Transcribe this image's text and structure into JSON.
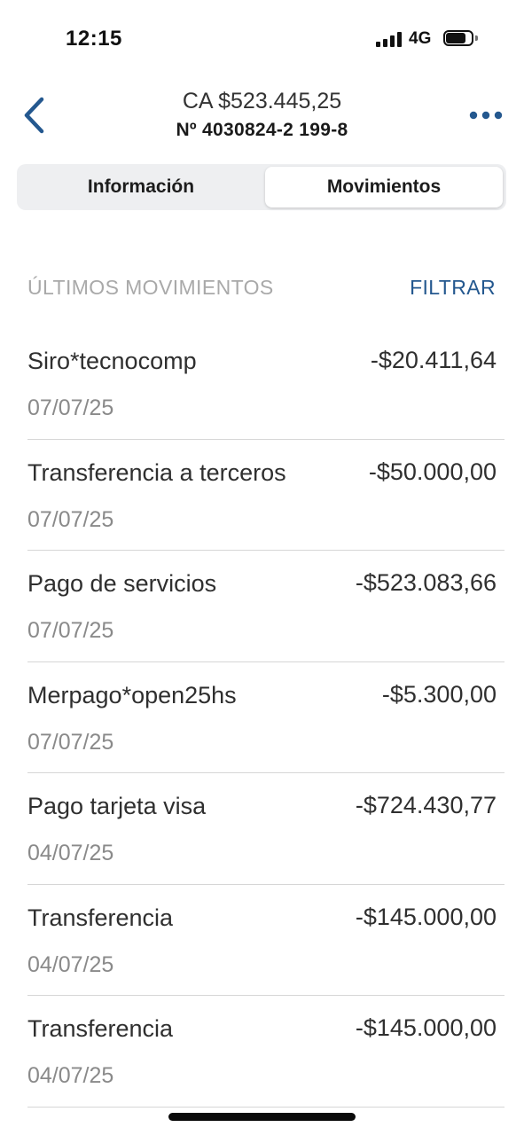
{
  "status_bar": {
    "time": "12:15",
    "network": "4G"
  },
  "header": {
    "account_title": "CA $523.445,25",
    "account_number": "Nº 4030824-2 199-8"
  },
  "tabs": [
    {
      "label": "Información",
      "selected": false
    },
    {
      "label": "Movimientos",
      "selected": true
    }
  ],
  "section": {
    "title": "ÚLTIMOS MOVIMIENTOS",
    "filter_label": "FILTRAR"
  },
  "movements": [
    {
      "description": "Siro*tecnocomp",
      "amount": "-$20.411,64",
      "date": "07/07/25"
    },
    {
      "description": "Transferencia a terceros",
      "amount": "-$50.000,00",
      "date": "07/07/25"
    },
    {
      "description": "Pago de servicios",
      "amount": "-$523.083,66",
      "date": "07/07/25"
    },
    {
      "description": "Merpago*open25hs",
      "amount": "-$5.300,00",
      "date": "07/07/25"
    },
    {
      "description": "Pago tarjeta visa",
      "amount": "-$724.430,77",
      "date": "04/07/25"
    },
    {
      "description": "Transferencia",
      "amount": "-$145.000,00",
      "date": "04/07/25"
    },
    {
      "description": "Transferencia",
      "amount": "-$145.000,00",
      "date": "04/07/25"
    }
  ],
  "colors": {
    "accent": "#24588f",
    "muted": "#a9a9a9",
    "date": "#8a8a8a",
    "divider": "#d6d6d6"
  },
  "icons": {
    "back": "chevron-left-icon",
    "more": "more-horizontal-icon",
    "signal": "signal-bars-icon",
    "battery": "battery-icon"
  }
}
